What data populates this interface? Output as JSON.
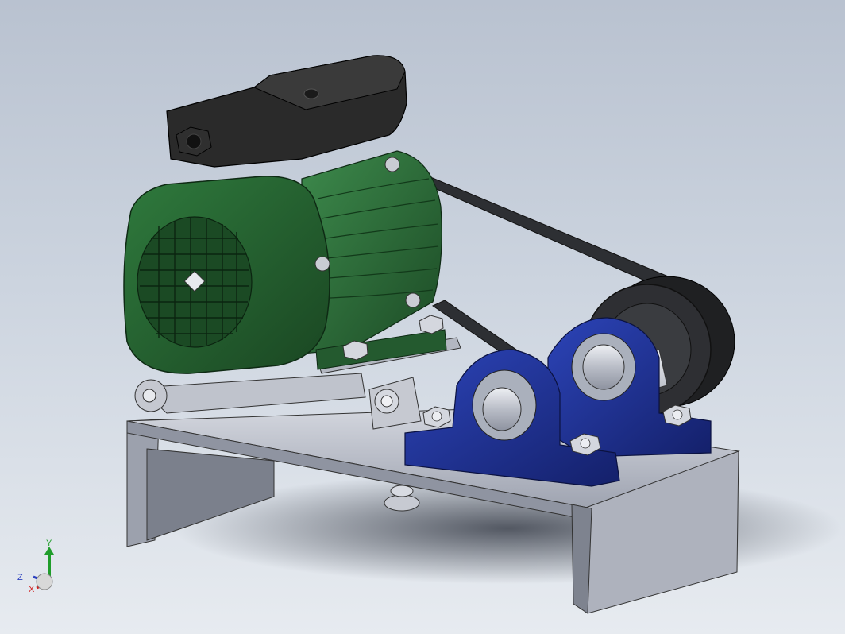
{
  "triad": {
    "y_label": "Y",
    "z_label": "Z",
    "x_label": "X",
    "colors": {
      "y": "#1f9d2a",
      "z": "#2a3fbf",
      "x": "#d01e1e"
    }
  },
  "colors": {
    "motor_green": "#2a6a36",
    "motor_dark_green": "#1c4a25",
    "terminal_box": "#2a2a2a",
    "pillow_block_blue": "#1c2f8f",
    "base_plate": "#b4b8c4",
    "pulley": "#2b2b2b",
    "shaft": "#c9ccd4"
  }
}
